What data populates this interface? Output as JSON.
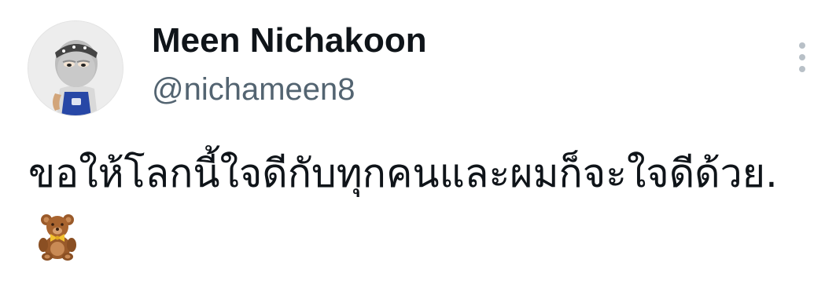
{
  "author": {
    "display_name": "Meen Nichakoon",
    "handle": "@nichameen8",
    "avatar_icon": "ninja-character-avatar"
  },
  "tweet": {
    "text": "ขอให้โลกนี้ใจดีกับทุกคนและผมก็จะใจดีด้วย.",
    "emoji": "teddy-bear-icon"
  },
  "more_menu": {
    "icon": "vertical-dots-icon"
  },
  "colors": {
    "text_primary": "#0f1419",
    "text_secondary": "#536471",
    "dots": "#b8c0c7",
    "background": "#ffffff"
  }
}
